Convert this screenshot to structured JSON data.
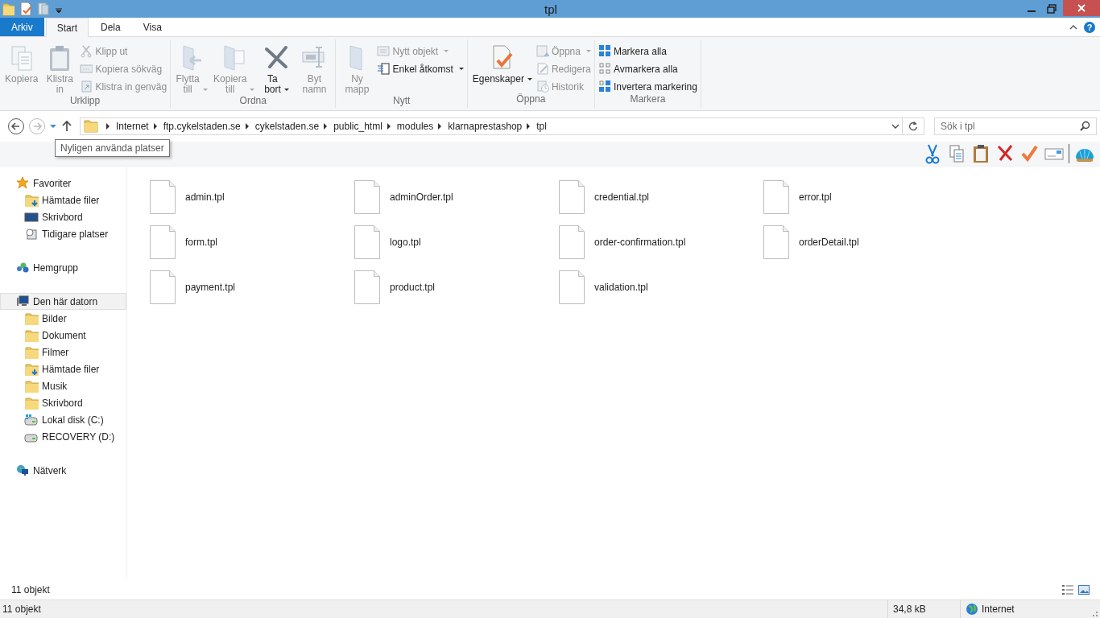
{
  "window": {
    "title": "tpl"
  },
  "ribbon_tabs": [
    {
      "label": "Arkiv",
      "kind": "file",
      "selected": false
    },
    {
      "label": "Start",
      "kind": "tab",
      "selected": true
    },
    {
      "label": "Dela",
      "kind": "tab",
      "selected": false
    },
    {
      "label": "Visa",
      "kind": "tab",
      "selected": false
    }
  ],
  "ribbon_groups": [
    {
      "label": "Urklipp",
      "items": [
        {
          "label": "Kopiera",
          "kind": "large",
          "disabled": true,
          "dropdown": false
        },
        {
          "label": "Klistra in",
          "kind": "large",
          "disabled": true,
          "dropdown": false
        },
        {
          "label": "Klipp ut",
          "kind": "small",
          "disabled": true,
          "dropdown": false
        },
        {
          "label": "Kopiera sökväg",
          "kind": "small",
          "disabled": true,
          "dropdown": false
        },
        {
          "label": "Klistra in genväg",
          "kind": "small",
          "disabled": true,
          "dropdown": false
        }
      ]
    },
    {
      "label": "Ordna",
      "items": [
        {
          "label": "Flytta till",
          "kind": "large",
          "disabled": true,
          "dropdown": true
        },
        {
          "label": "Kopiera till",
          "kind": "large",
          "disabled": true,
          "dropdown": true
        },
        {
          "label": "Ta bort",
          "kind": "large",
          "disabled": false,
          "dropdown": true
        },
        {
          "label": "Byt namn",
          "kind": "large",
          "disabled": true,
          "dropdown": false
        }
      ]
    },
    {
      "label": "Nytt",
      "items": [
        {
          "label": "Ny mapp",
          "kind": "large",
          "disabled": true,
          "dropdown": false
        },
        {
          "label": "Nytt objekt",
          "kind": "small",
          "disabled": true,
          "dropdown": true
        },
        {
          "label": "Enkel åtkomst",
          "kind": "small",
          "disabled": false,
          "dropdown": true
        }
      ]
    },
    {
      "label": "Öppna",
      "items": [
        {
          "label": "Egenskaper",
          "kind": "large",
          "disabled": false,
          "dropdown": true
        },
        {
          "label": "Öppna",
          "kind": "small",
          "disabled": true,
          "dropdown": true
        },
        {
          "label": "Redigera",
          "kind": "small",
          "disabled": true,
          "dropdown": false
        },
        {
          "label": "Historik",
          "kind": "small",
          "disabled": true,
          "dropdown": false
        }
      ]
    },
    {
      "label": "Markera",
      "items": [
        {
          "label": "Markera alla",
          "kind": "small",
          "disabled": false,
          "dropdown": false
        },
        {
          "label": "Avmarkera alla",
          "kind": "small",
          "disabled": false,
          "dropdown": false
        },
        {
          "label": "Invertera markering",
          "kind": "small",
          "disabled": false,
          "dropdown": false
        }
      ]
    }
  ],
  "help_button": "?",
  "address": {
    "path": [
      "Internet",
      "ftp.cykelstaden.se",
      "cykelstaden.se",
      "public_html",
      "modules",
      "klarnaprestashop",
      "tpl"
    ],
    "search": {
      "placeholder": "Sök i tpl"
    },
    "forward_disabled": true
  },
  "tooltip": "Nyligen använda platser",
  "navigation": [
    {
      "label": "Favoriter",
      "selected": false,
      "children": [
        {
          "label": "Hämtade filer",
          "selected": false
        },
        {
          "label": "Skrivbord",
          "selected": false
        },
        {
          "label": "Tidigare platser",
          "selected": false
        }
      ]
    },
    {
      "label": "Hemgrupp",
      "selected": false
    },
    {
      "label": "Den här datorn",
      "selected": true,
      "children": [
        {
          "label": "Bilder",
          "selected": false
        },
        {
          "label": "Dokument",
          "selected": false
        },
        {
          "label": "Filmer",
          "selected": false
        },
        {
          "label": "Hämtade filer",
          "selected": false
        },
        {
          "label": "Musik",
          "selected": false
        },
        {
          "label": "Skrivbord",
          "selected": false
        },
        {
          "label": "Lokal disk (C:)",
          "selected": false
        },
        {
          "label": "RECOVERY (D:)",
          "selected": false
        }
      ]
    },
    {
      "label": "Nätverk",
      "selected": false
    }
  ],
  "files": [
    {
      "name": "admin.tpl"
    },
    {
      "name": "adminOrder.tpl"
    },
    {
      "name": "credential.tpl"
    },
    {
      "name": "error.tpl"
    },
    {
      "name": "form.tpl"
    },
    {
      "name": "logo.tpl"
    },
    {
      "name": "order-confirmation.tpl"
    },
    {
      "name": "orderDetail.tpl"
    },
    {
      "name": "payment.tpl"
    },
    {
      "name": "product.tpl"
    },
    {
      "name": "validation.tpl"
    }
  ],
  "item_count": "11 objekt",
  "status_bar": {
    "count": "11 objekt",
    "size": "34,8 kB",
    "zone": "Internet"
  }
}
